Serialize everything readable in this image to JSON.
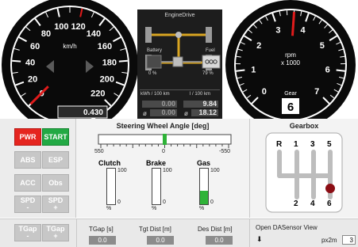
{
  "speedometer": {
    "unit": "km/h",
    "ticks": [
      "0",
      "20",
      "40",
      "60",
      "80",
      "100",
      "120",
      "140",
      "160",
      "180",
      "200",
      "220"
    ],
    "value_kmh": 0,
    "odometer": "0.430"
  },
  "tachometer": {
    "unit_line1": "rpm",
    "unit_line2": "x 1000",
    "ticks": [
      "0",
      "1",
      "2",
      "3",
      "4",
      "5",
      "6",
      "7"
    ],
    "value_rpm_k": 3.6,
    "gear_label": "Gear",
    "gear_value": "6"
  },
  "engine_drive": {
    "title": "EngineDrive",
    "battery_label": "Battery",
    "battery_pct": "0 %",
    "fuel_label": "Fuel",
    "fuel_pct": "79 %",
    "kwh_label": "kWh / 100 km",
    "l_label": "l / 100 km",
    "kwh_current": "0.00",
    "kwh_avg": "0.00",
    "l_current": "9.84",
    "l_avg": "18.12",
    "avg_symbol": "ø"
  },
  "controls": {
    "pwr": "PWR",
    "start": "START",
    "abs": "ABS",
    "esp": "ESP",
    "acc": "ACC",
    "obs": "Obs",
    "spd_minus_1": "SPD",
    "spd_minus_2": "-",
    "spd_plus_1": "SPD",
    "spd_plus_2": "+",
    "tgap_minus_1": "TGap",
    "tgap_minus_2": "-",
    "tgap_plus_1": "TGap",
    "tgap_plus_2": "+"
  },
  "steering": {
    "title": "Steering Wheel Angle [deg]",
    "left_tick": "550",
    "center_tick": "0",
    "right_tick": "-550",
    "value_deg": 0
  },
  "pedals": [
    {
      "name": "Clutch",
      "max": "100",
      "min": "0",
      "unit": "%",
      "level": 0
    },
    {
      "name": "Brake",
      "max": "100",
      "min": "0",
      "unit": "%",
      "level": 0
    },
    {
      "name": "Gas",
      "max": "100",
      "min": "0",
      "unit": "%",
      "level": 0.38
    }
  ],
  "gearbox": {
    "title": "Gearbox",
    "top_labels": [
      "R",
      "1",
      "3",
      "5"
    ],
    "bottom_labels": [
      "2",
      "4",
      "6"
    ],
    "selected": "6"
  },
  "bottom": {
    "tgap_label": "TGap [s]",
    "tgap_value": "0.0",
    "tgt_dist_label": "Tgt Dist [m]",
    "tgt_dist_value": "0.0",
    "des_dist_label": "Des Dist [m]",
    "des_dist_value": "0.0",
    "sensor_view": "Open DASensor View",
    "px2m_label": "px2m",
    "px2m_value": "3"
  },
  "colors": {
    "gauge_bg": "#0a0a0a",
    "needle_red": "#e01b1b",
    "accent_yellow": "#d9a521",
    "gas_green": "#2fb338"
  }
}
